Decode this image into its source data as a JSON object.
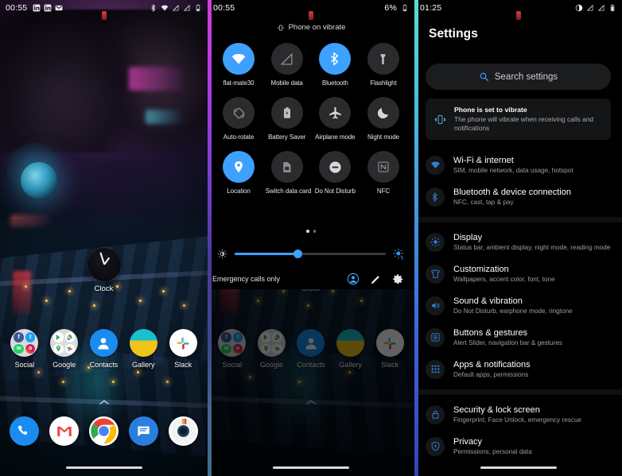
{
  "panels": {
    "home": {
      "statusbar": {
        "clock": "00:55",
        "notif_icons": [
          "linkedin-icon",
          "linkedin-icon",
          "gmail-icon"
        ],
        "right_icons": [
          "bluetooth-icon",
          "wifi-icon",
          "signal-off-icon",
          "signal-off-icon",
          "battery-icon"
        ]
      },
      "clock_widget": {
        "label": "Clock"
      },
      "apps": [
        {
          "label": "Social",
          "icon": "social-folder-icon"
        },
        {
          "label": "Google",
          "icon": "google-folder-icon"
        },
        {
          "label": "Contacts",
          "icon": "contacts-icon"
        },
        {
          "label": "Gallery",
          "icon": "gallery-icon"
        },
        {
          "label": "Slack",
          "icon": "slack-icon"
        }
      ],
      "dock": [
        {
          "label": "Phone",
          "icon": "phone-icon"
        },
        {
          "label": "Gmail",
          "icon": "gmail-icon"
        },
        {
          "label": "Chrome",
          "icon": "chrome-icon"
        },
        {
          "label": "Messages",
          "icon": "messages-icon"
        },
        {
          "label": "Camera",
          "icon": "camera-icon"
        }
      ]
    },
    "quick_settings": {
      "statusbar": {
        "clock": "00:55",
        "battery_percent": "6%"
      },
      "vibrate_banner": "Phone on vibrate",
      "tiles": [
        {
          "label": "flat-mate30",
          "icon": "wifi-icon",
          "active": true
        },
        {
          "label": "Mobile data",
          "icon": "mobile-data-off-icon",
          "active": false
        },
        {
          "label": "Bluetooth",
          "icon": "bluetooth-icon",
          "active": true
        },
        {
          "label": "Flashlight",
          "icon": "flashlight-icon",
          "active": false
        },
        {
          "label": "Auto-rotate",
          "icon": "auto-rotate-icon",
          "active": false
        },
        {
          "label": "Battery Saver",
          "icon": "battery-saver-icon",
          "active": false
        },
        {
          "label": "Airplane mode",
          "icon": "airplane-icon",
          "active": false
        },
        {
          "label": "Night mode",
          "icon": "moon-icon",
          "active": false
        },
        {
          "label": "Location",
          "icon": "location-pin-icon",
          "active": true
        },
        {
          "label": "Switch data card",
          "icon": "sim-switch-icon",
          "active": false
        },
        {
          "label": "Do Not Disturb",
          "icon": "do-not-disturb-icon",
          "active": false
        },
        {
          "label": "NFC",
          "icon": "nfc-icon",
          "active": false
        }
      ],
      "page_dots": {
        "count": 2,
        "active_index": 0
      },
      "brightness": {
        "value_percent": 42,
        "left_icon": "brightness-low-icon",
        "right_icon": "brightness-auto-icon"
      },
      "footer": {
        "carrier_text": "Emergency calls only",
        "buttons": [
          {
            "name": "user-account-icon"
          },
          {
            "name": "edit-pencil-icon"
          },
          {
            "name": "settings-gear-icon"
          }
        ]
      },
      "behind_home": {
        "clock_label": "Clock",
        "apps": [
          "Social",
          "Google",
          "Contacts",
          "Gallery",
          "Slack"
        ]
      }
    },
    "settings": {
      "statusbar": {
        "clock": "01:25",
        "right_icons": [
          "do-not-disturb-icon",
          "signal-off-icon",
          "signal-off-icon",
          "battery-icon"
        ]
      },
      "title": "Settings",
      "search": {
        "placeholder": "Search settings",
        "icon": "search-icon"
      },
      "vibrate_card": {
        "icon": "vibrate-icon",
        "title": "Phone is set to vibrate",
        "subtitle": "The phone will vibrate when receiving calls and notifications"
      },
      "groups": [
        {
          "items": [
            {
              "icon": "wifi-icon",
              "title": "Wi-Fi & internet",
              "subtitle": "SIM, mobile network, data usage, hotspot"
            },
            {
              "icon": "bluetooth-icon",
              "title": "Bluetooth & device connection",
              "subtitle": "NFC, cast, tap & pay"
            }
          ]
        },
        {
          "items": [
            {
              "icon": "display-icon",
              "title": "Display",
              "subtitle": "Status bar, ambient display, night mode, reading mode"
            },
            {
              "icon": "tshirt-icon",
              "title": "Customization",
              "subtitle": "Wallpapers, accent color, font, tone"
            },
            {
              "icon": "speaker-icon",
              "title": "Sound & vibration",
              "subtitle": "Do Not Disturb, earphone mode, ringtone"
            },
            {
              "icon": "buttons-icon",
              "title": "Buttons & gestures",
              "subtitle": "Alert Slider, navigation bar & gestures"
            },
            {
              "icon": "apps-grid-icon",
              "title": "Apps & notifications",
              "subtitle": "Default apps, permissions"
            }
          ]
        },
        {
          "items": [
            {
              "icon": "lock-icon",
              "title": "Security & lock screen",
              "subtitle": "Fingerprint, Face Unlock, emergency rescue"
            },
            {
              "icon": "shield-icon",
              "title": "Privacy",
              "subtitle": "Permissions, personal data"
            }
          ]
        }
      ]
    }
  },
  "colors": {
    "accent_blue": "#3ea1ff",
    "tile_off": "#2b2b2d",
    "panel_bg": "#000000",
    "edge_qs": "#b43ce0",
    "edge_settings": "#46b0dd"
  }
}
